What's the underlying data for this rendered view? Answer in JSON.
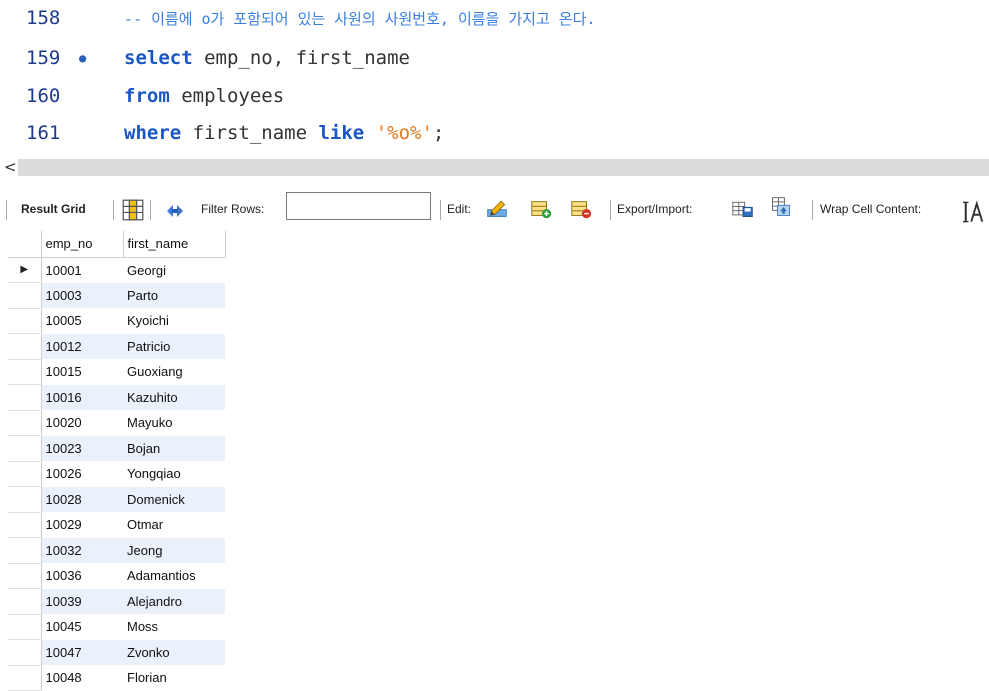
{
  "editor": {
    "lines": [
      {
        "no": "158",
        "dot": "",
        "kind": "comment",
        "tokens": [
          {
            "t": "-- 이름에 o가 포함되어 있는 사원의 사원번호, 이름을 가지고 온다.",
            "c": "comment"
          }
        ]
      },
      {
        "no": "159",
        "dot": "●",
        "kind": "code",
        "tokens": [
          {
            "t": "select",
            "c": "kw"
          },
          {
            "t": " emp_no, first_name",
            "c": "plain"
          }
        ]
      },
      {
        "no": "160",
        "dot": "",
        "kind": "code",
        "tokens": [
          {
            "t": "from",
            "c": "kw"
          },
          {
            "t": " employees",
            "c": "plain"
          }
        ]
      },
      {
        "no": "161",
        "dot": "",
        "kind": "code",
        "tokens": [
          {
            "t": "where",
            "c": "kw"
          },
          {
            "t": " first_name ",
            "c": "plain"
          },
          {
            "t": "like",
            "c": "kw"
          },
          {
            "t": " ",
            "c": "plain"
          },
          {
            "t": "'%o%'",
            "c": "str"
          },
          {
            "t": ";",
            "c": "plain"
          }
        ]
      }
    ],
    "scroll_arrow": "<"
  },
  "toolbar": {
    "result_grid": "Result Grid",
    "filter_rows": "Filter Rows:",
    "filter_value": "",
    "edit": "Edit:",
    "export_import": "Export/Import:",
    "wrap_cell": "Wrap Cell Content:"
  },
  "grid": {
    "columns": [
      "emp_no",
      "first_name"
    ],
    "current_row_marker": "▶",
    "rows": [
      [
        "10001",
        "Georgi"
      ],
      [
        "10003",
        "Parto"
      ],
      [
        "10005",
        "Kyoichi"
      ],
      [
        "10012",
        "Patricio"
      ],
      [
        "10015",
        "Guoxiang"
      ],
      [
        "10016",
        "Kazuhito"
      ],
      [
        "10020",
        "Mayuko"
      ],
      [
        "10023",
        "Bojan"
      ],
      [
        "10026",
        "Yongqiao"
      ],
      [
        "10028",
        "Domenick"
      ],
      [
        "10029",
        "Otmar"
      ],
      [
        "10032",
        "Jeong"
      ],
      [
        "10036",
        "Adamantios"
      ],
      [
        "10039",
        "Alejandro"
      ],
      [
        "10045",
        "Moss"
      ],
      [
        "10047",
        "Zvonko"
      ],
      [
        "10048",
        "Florian"
      ]
    ]
  },
  "colors": {
    "keyword": "#1a56c4",
    "string": "#e07a1f",
    "comment": "#3a7fe0",
    "line_number": "#1e3a8a",
    "row_alt": "#eaf1fb"
  }
}
